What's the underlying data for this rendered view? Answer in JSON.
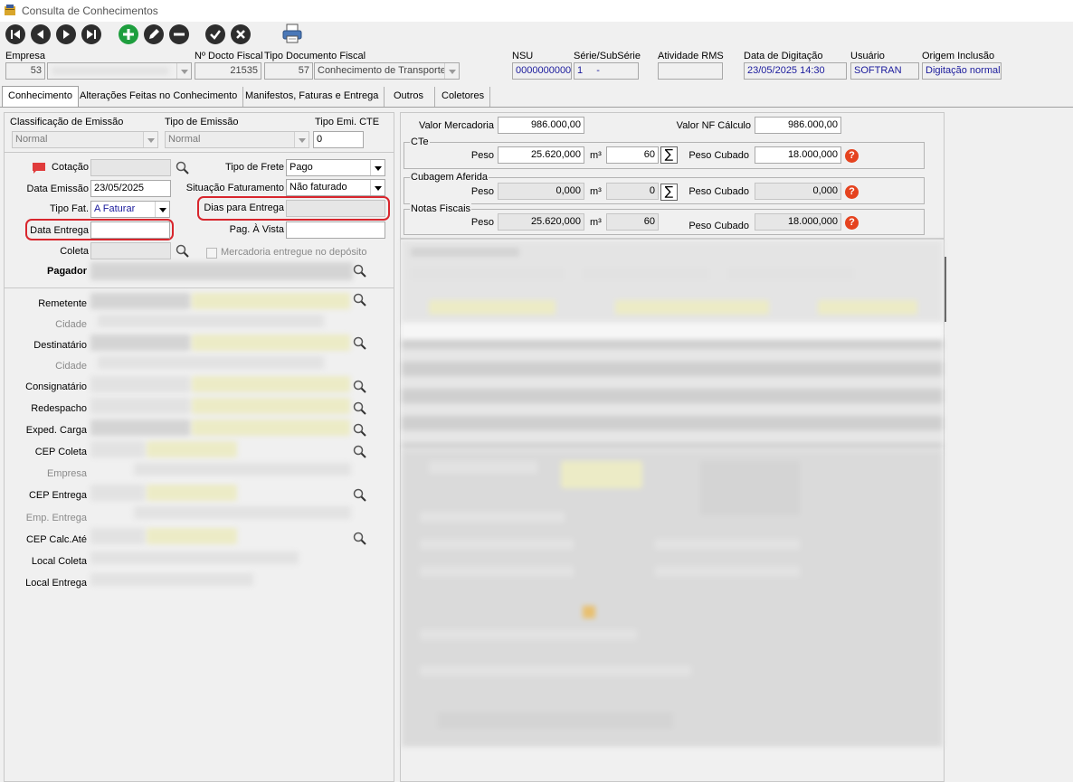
{
  "window": {
    "title": "Consulta de Conhecimentos"
  },
  "header": {
    "empresa_label": "Empresa",
    "empresa_code": "53",
    "num_docto_label": "Nº Docto Fiscal",
    "num_docto_value": "21535",
    "tipo_doc_label": "Tipo Documento Fiscal",
    "tipo_doc_code": "57",
    "tipo_doc_value": "Conhecimento de Transporte",
    "nsu_label": "NSU",
    "nsu_value": "0000000000",
    "serie_label": "Série/SubSérie",
    "serie_value": "1",
    "subserie_value": "-",
    "atividade_label": "Atividade RMS",
    "atividade_value": "",
    "data_dig_label": "Data de Digitação",
    "data_dig_value": "23/05/2025 14:30",
    "usuario_label": "Usuário",
    "usuario_value": "SOFTRAN",
    "origem_label": "Origem Inclusão",
    "origem_value": "Digitação normal"
  },
  "tabs": [
    {
      "label": "Conhecimento"
    },
    {
      "label": "Alterações Feitas no Conhecimento"
    },
    {
      "label": "Manifestos, Faturas e Entrega"
    },
    {
      "label": "Outros"
    },
    {
      "label": "Coletores"
    }
  ],
  "left": {
    "classif_label": "Classificação de Emissão",
    "classif_value": "Normal",
    "tipo_emissao_label": "Tipo de Emissão",
    "tipo_emissao_value": "Normal",
    "tipo_emi_cte_label": "Tipo Emi. CTE",
    "tipo_emi_cte_value": "0",
    "cotacao_label": "Cotação",
    "cotacao_value": "",
    "tipo_frete_label": "Tipo de Frete",
    "tipo_frete_value": "Pago",
    "data_emissao_label": "Data Emissão",
    "data_emissao_value": "23/05/2025",
    "situacao_label": "Situação Faturamento",
    "situacao_value": "Não faturado",
    "tipo_fat_label": "Tipo Fat.",
    "tipo_fat_value": "A Faturar",
    "dias_entrega_label": "Dias para Entrega",
    "dias_entrega_value": "",
    "data_entrega_label": "Data Entrega",
    "data_entrega_value": "",
    "pag_vista_label": "Pag. À Vista",
    "pag_vista_value": "",
    "coleta_label": "Coleta",
    "coleta_value": "",
    "merc_entregue_label": "Mercadoria entregue no depósito",
    "pagador_label": "Pagador",
    "remetente_label": "Remetente",
    "cidade1_label": "Cidade",
    "destinatario_label": "Destinatário",
    "cidade2_label": "Cidade",
    "consignatario_label": "Consignatário",
    "redespacho_label": "Redespacho",
    "exped_label": "Exped. Carga",
    "cep_coleta_label": "CEP Coleta",
    "empresa2_label": "Empresa",
    "cep_entrega_label": "CEP Entrega",
    "emp_entrega_label": "Emp. Entrega",
    "cep_calc_label": "CEP Calc.Até",
    "local_coleta_label": "Local Coleta",
    "local_entrega_label": "Local Entrega"
  },
  "right": {
    "valor_merc_label": "Valor Mercadoria",
    "valor_merc_value": "986.000,00",
    "valor_nf_label": "Valor NF Cálculo",
    "valor_nf_value": "986.000,00",
    "cte_title": "CTe",
    "cte_peso_label": "Peso",
    "cte_peso_value": "25.620,000",
    "cte_m3_label": "m³",
    "cte_m3_value": "60",
    "cte_peso_cub_label": "Peso Cubado",
    "cte_peso_cub_value": "18.000,000",
    "cub_title": "Cubagem Aferida",
    "cub_peso_label": "Peso",
    "cub_peso_value": "0,000",
    "cub_m3_label": "m³",
    "cub_m3_value": "0",
    "cub_peso_cub_label": "Peso Cubado",
    "cub_peso_cub_value": "0,000",
    "nf_title": "Notas Fiscais",
    "nf_peso_label": "Peso",
    "nf_peso_value": "25.620,000",
    "nf_m3_label": "m³",
    "nf_m3_value": "60",
    "nf_peso_cub_label": "Peso Cubado",
    "nf_peso_cub_value": "18.000,000",
    "sigma_symbol": "∑",
    "help_symbol": "?"
  },
  "colors": {
    "highlight_red": "#d8262d",
    "toolbar_green": "#1e9e3e",
    "help_red": "#e5431f",
    "value_blue": "#1a1a9c"
  }
}
